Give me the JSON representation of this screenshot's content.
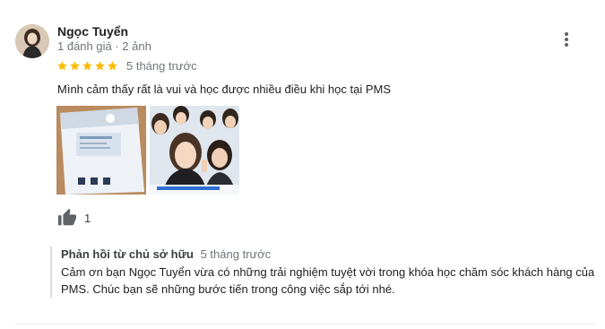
{
  "review": {
    "author": "Ngọc Tuyển",
    "meta": "1 đánh giá · 2 ảnh",
    "rating": 5,
    "rating_max": 5,
    "time": "5 tháng trước",
    "text": "Mình cảm thấy rất là vui và học được nhiều điều khi học tại PMS",
    "likes": "1"
  },
  "icons": {
    "menu": "more-vert-icon",
    "star": "star-icon",
    "like": "thumb-up-icon"
  },
  "owner_reply": {
    "label": "Phản hồi từ chủ sở hữu",
    "time": "5 tháng trước",
    "text": "Cảm ơn bạn Ngọc Tuyển vừa có những trải nghiệm tuyệt vời trong khóa học chăm sóc khách hàng của PMS. Chúc bạn sẽ những bước tiến trong công việc sắp tới nhé."
  },
  "colors": {
    "star": "#fbbc04",
    "icon": "#5f6368"
  }
}
